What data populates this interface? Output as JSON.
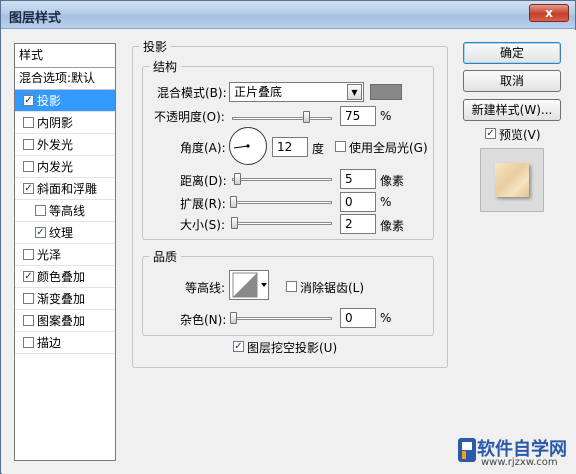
{
  "window": {
    "title": "图层样式",
    "close_symbol": "x"
  },
  "style_list": {
    "header": "样式",
    "blend": "混合选项:默认",
    "items": [
      {
        "label": "投影",
        "checked": true,
        "selected": true,
        "sub": false
      },
      {
        "label": "内阴影",
        "checked": false,
        "selected": false,
        "sub": false
      },
      {
        "label": "外发光",
        "checked": false,
        "selected": false,
        "sub": false
      },
      {
        "label": "内发光",
        "checked": false,
        "selected": false,
        "sub": false
      },
      {
        "label": "斜面和浮雕",
        "checked": true,
        "selected": false,
        "sub": false
      },
      {
        "label": "等高线",
        "checked": false,
        "selected": false,
        "sub": true
      },
      {
        "label": "纹理",
        "checked": true,
        "selected": false,
        "sub": true
      },
      {
        "label": "光泽",
        "checked": false,
        "selected": false,
        "sub": false
      },
      {
        "label": "颜色叠加",
        "checked": true,
        "selected": false,
        "sub": false
      },
      {
        "label": "渐变叠加",
        "checked": false,
        "selected": false,
        "sub": false
      },
      {
        "label": "图案叠加",
        "checked": false,
        "selected": false,
        "sub": false
      },
      {
        "label": "描边",
        "checked": false,
        "selected": false,
        "sub": false
      }
    ]
  },
  "drop_shadow": {
    "title": "投影",
    "structure": {
      "title": "结构",
      "blend_mode_label": "混合模式(B):",
      "blend_mode_value": "正片叠底",
      "shadow_color": "#888888",
      "opacity_label": "不透明度(O):",
      "opacity_value": "75",
      "opacity_unit": "%",
      "opacity_fraction": 0.75,
      "angle_label": "角度(A):",
      "angle_value": "12",
      "angle_unit": "度",
      "global_light_label": "使用全局光(G)",
      "global_light_checked": false,
      "distance_label": "距离(D):",
      "distance_value": "5",
      "distance_unit": "像素",
      "spread_label": "扩展(R):",
      "spread_value": "0",
      "spread_unit": "%",
      "size_label": "大小(S):",
      "size_value": "2",
      "size_unit": "像素"
    },
    "quality": {
      "title": "品质",
      "contour_label": "等高线:",
      "antialias_label": "消除锯齿(L)",
      "antialias_checked": false,
      "noise_label": "杂色(N):",
      "noise_value": "0",
      "noise_unit": "%"
    },
    "knockout_label": "图层挖空投影(U)",
    "knockout_checked": true
  },
  "buttons": {
    "ok": "确定",
    "cancel": "取消",
    "new_style": "新建样式(W)...",
    "preview_label": "预览(V)",
    "preview_checked": true
  },
  "watermark": {
    "main": "软件自学网",
    "sub": "www.rjzxw.com"
  }
}
